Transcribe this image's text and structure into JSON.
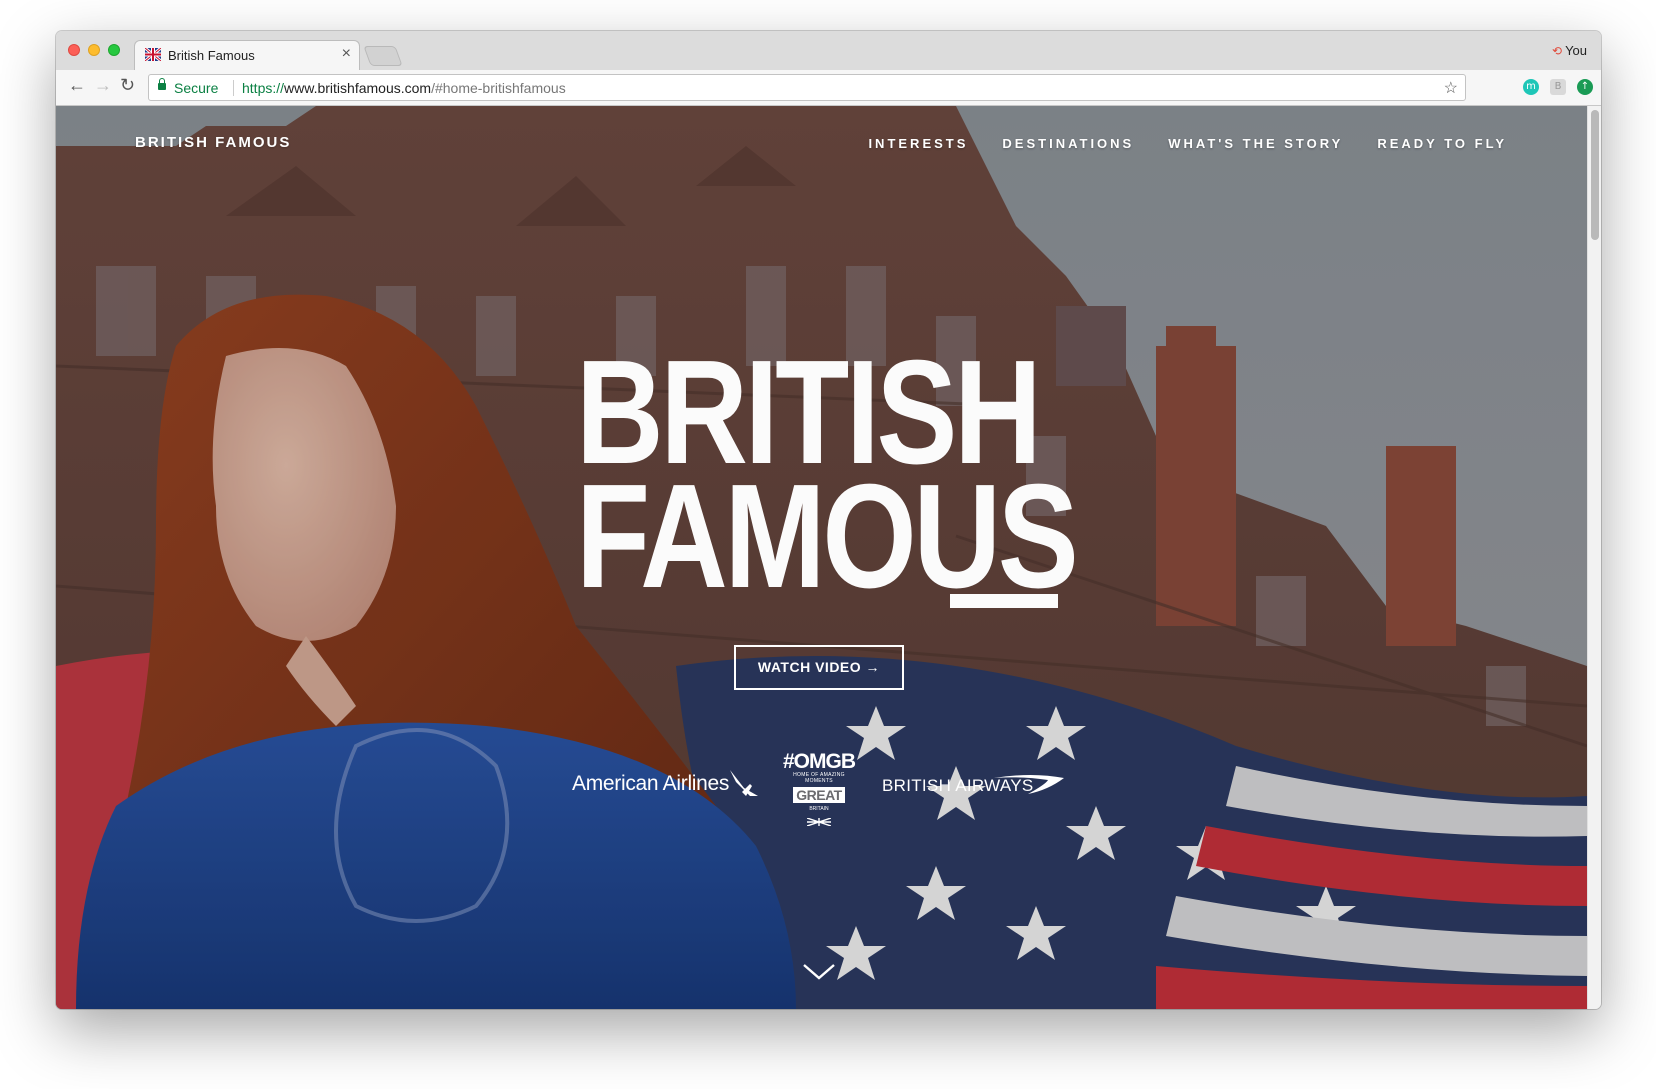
{
  "browser": {
    "tab_title": "British Famous",
    "tab_close": "×",
    "profile_name": "You",
    "security_label": "Secure",
    "url_scheme": "https://",
    "url_host": "www.britishfamous.com",
    "url_path": "/#home-britishfamous"
  },
  "site": {
    "brand": "BRITISH FAMOUS",
    "nav": [
      "INTERESTS",
      "DESTINATIONS",
      "WHAT'S THE STORY",
      "READY TO FLY"
    ],
    "headline_line1": "BRITISH",
    "headline_line2": "FAMOUS",
    "cta": "WATCH VIDEO →",
    "partners": {
      "american_airlines": "American Airlines",
      "omgb_tag": "#OMGB",
      "omgb_sub": "HOME OF AMAZING MOMENTS",
      "omgb_great": "GREAT",
      "omgb_britain": "BRITAIN",
      "british_airways": "BRITISH AIRWAYS"
    }
  },
  "icons": {
    "back": "back-arrow-icon",
    "forward": "forward-arrow-icon",
    "reload": "reload-icon",
    "bookmark": "star-icon",
    "scroll": "chevron-down-icon"
  },
  "colors": {
    "secure_green": "#0b8043",
    "hero_text": "#fbfbfb",
    "hair": "#8a3a1e",
    "jacket_blue": "#1d3f8a",
    "flag_red": "#c8323c",
    "flag_blue": "#2b3a66"
  }
}
